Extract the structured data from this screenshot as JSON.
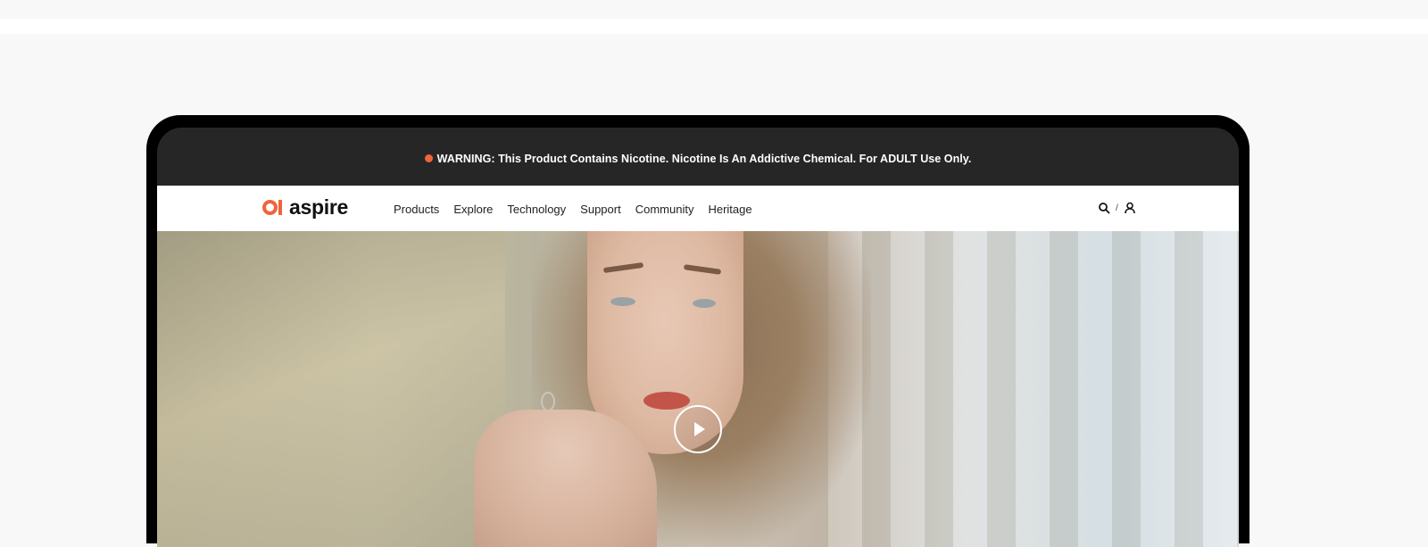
{
  "warning": {
    "text": "WARNING: This Product Contains Nicotine. Nicotine Is An Addictive Chemical. For ADULT Use Only.",
    "dot_color": "#f0643c"
  },
  "brand": {
    "name": "aspire",
    "accent_color": "#f0643c"
  },
  "nav": {
    "items": [
      "Products",
      "Explore",
      "Technology",
      "Support",
      "Community",
      "Heritage"
    ],
    "search_icon": "search-icon",
    "separator": "/",
    "account_icon": "user-icon"
  },
  "hero": {
    "play_icon": "play-icon"
  }
}
